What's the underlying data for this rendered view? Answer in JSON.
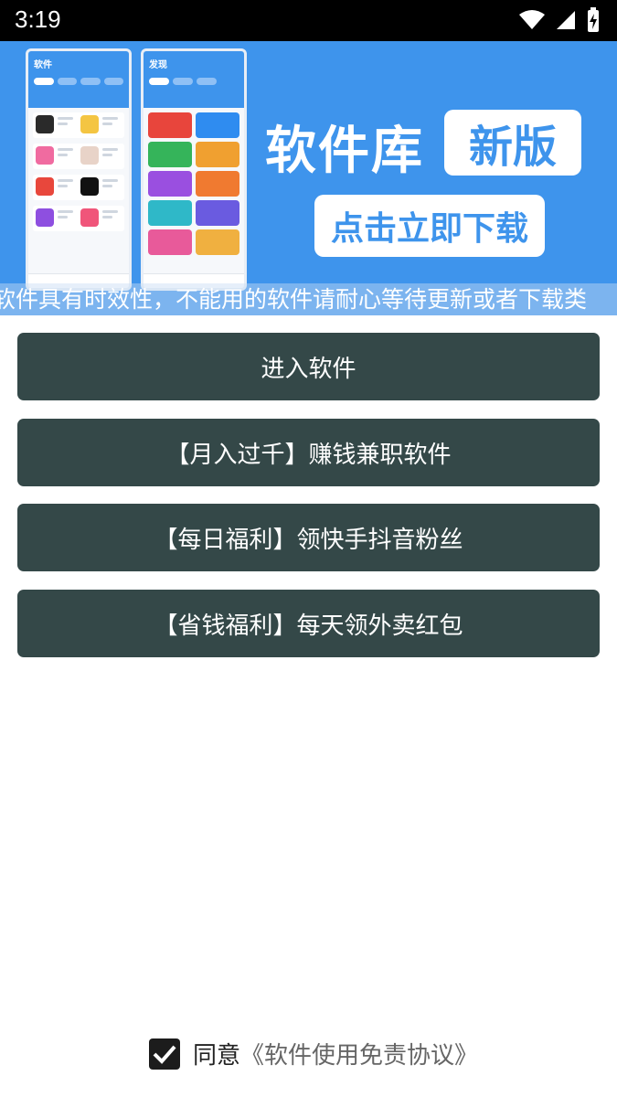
{
  "status_bar": {
    "time": "3:19"
  },
  "banner": {
    "title": "软件库",
    "badge": "新版",
    "download_label": "点击立即下载",
    "marquee": "软件具有时效性，不能用的软件请耐心等待更新或者下载类",
    "phone_left_title": "软件",
    "phone_right_title": "发现"
  },
  "menu": {
    "items": [
      {
        "label": "进入软件"
      },
      {
        "label": "【月入过千】赚钱兼职软件"
      },
      {
        "label": "【每日福利】领快手抖音粉丝"
      },
      {
        "label": "【省钱福利】每天领外卖红包"
      }
    ]
  },
  "agreement": {
    "checked": true,
    "prefix": "同意",
    "link": "《软件使用免责协议》"
  },
  "colors": {
    "banner_blue": "#3e94ec",
    "button_dark": "#344848",
    "status_bar": "#000000"
  }
}
